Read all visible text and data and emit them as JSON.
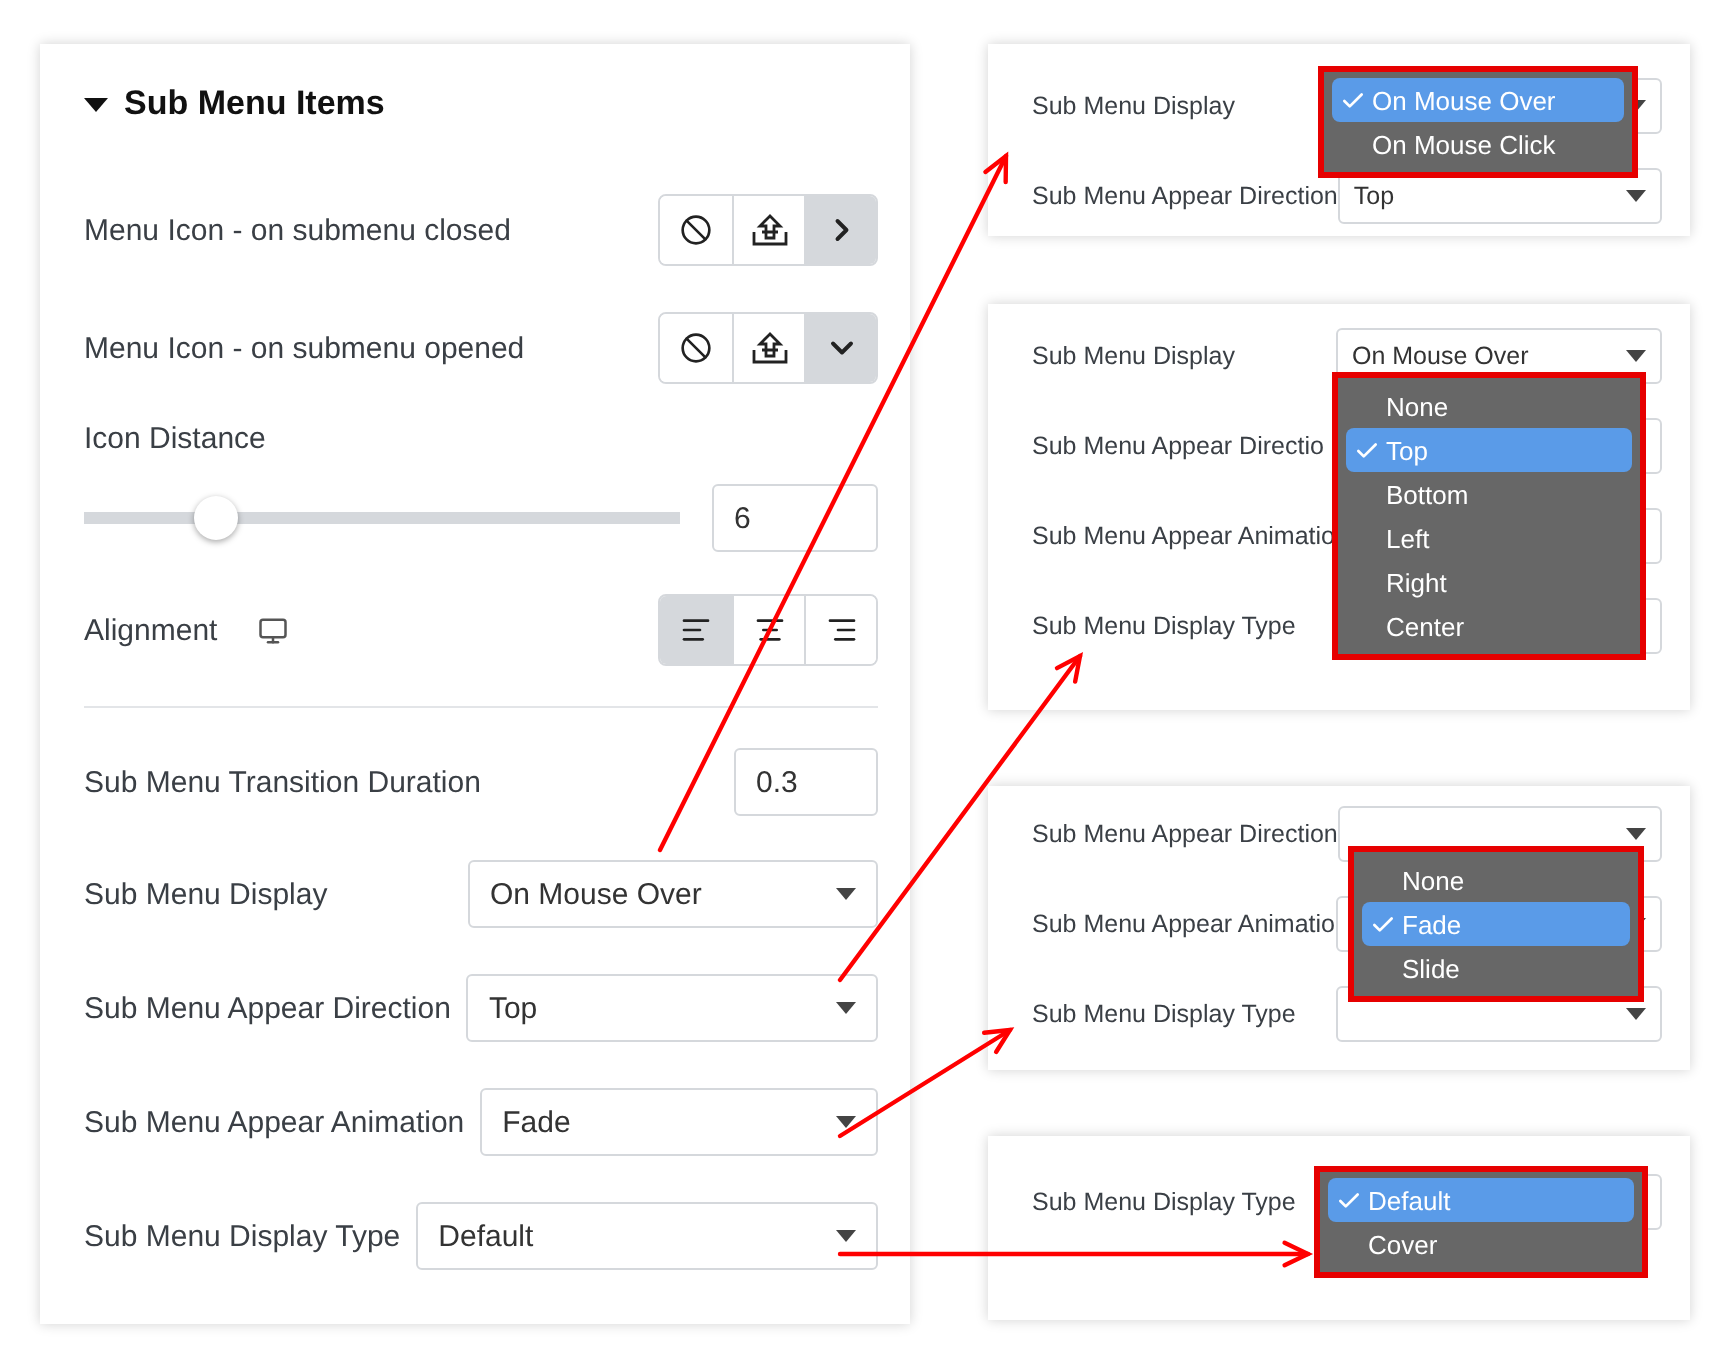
{
  "section": {
    "title": "Sub Menu Items",
    "expanded": true
  },
  "icon_controls": [
    {
      "label": "Menu Icon - on submenu closed",
      "options": [
        {
          "kind": "none",
          "selected": false
        },
        {
          "kind": "upload",
          "selected": false
        },
        {
          "kind": "chevron-right",
          "selected": true
        }
      ]
    },
    {
      "label": "Menu Icon - on submenu opened",
      "options": [
        {
          "kind": "none",
          "selected": false
        },
        {
          "kind": "upload",
          "selected": false
        },
        {
          "kind": "chevron-down",
          "selected": true
        }
      ]
    }
  ],
  "slider": {
    "label": "Icon Distance",
    "level": 0.22,
    "value": "6"
  },
  "alignment": {
    "label": "Alignment",
    "options": [
      {
        "kind": "left",
        "selected": true
      },
      {
        "kind": "center",
        "selected": false
      },
      {
        "kind": "right",
        "selected": false
      }
    ]
  },
  "transition": {
    "label": "Sub Menu Transition Duration",
    "value": "0.3"
  },
  "selects": [
    {
      "label": "Sub Menu Display",
      "value": "On Mouse Over"
    },
    {
      "label": "Sub Menu Appear Direction",
      "value": "Top"
    },
    {
      "label": "Sub Menu Appear Animation",
      "value": "Fade"
    },
    {
      "label": "Sub Menu Display Type",
      "value": "Default"
    }
  ],
  "previews": [
    {
      "rows": [
        {
          "label": "Sub Menu Display"
        },
        {
          "label": "Sub Menu Appear Direction",
          "value": "Top"
        }
      ],
      "menu": [
        {
          "label": "On Mouse Over",
          "selected": true
        },
        {
          "label": "On Mouse Click",
          "selected": false
        }
      ]
    },
    {
      "rows": [
        {
          "label": "Sub Menu Display",
          "value": "On Mouse Over"
        },
        {
          "label": "Sub Menu Appear Directio"
        },
        {
          "label": "Sub Menu Appear Animatio"
        },
        {
          "label": "Sub Menu Display Type"
        }
      ],
      "menu": [
        {
          "label": "None",
          "selected": false
        },
        {
          "label": "Top",
          "selected": true
        },
        {
          "label": "Bottom",
          "selected": false
        },
        {
          "label": "Left",
          "selected": false
        },
        {
          "label": "Right",
          "selected": false
        },
        {
          "label": "Center",
          "selected": false
        }
      ]
    },
    {
      "rows": [
        {
          "label": "Sub Menu Appear Direction"
        },
        {
          "label": "Sub Menu Appear Animatio"
        },
        {
          "label": "Sub Menu Display Type"
        }
      ],
      "menu": [
        {
          "label": "None",
          "selected": false
        },
        {
          "label": "Fade",
          "selected": true
        },
        {
          "label": "Slide",
          "selected": false
        }
      ]
    },
    {
      "rows": [
        {
          "label": "Sub Menu Display Type"
        }
      ],
      "menu": [
        {
          "label": "Default",
          "selected": true
        },
        {
          "label": "Cover",
          "selected": false
        }
      ]
    }
  ]
}
